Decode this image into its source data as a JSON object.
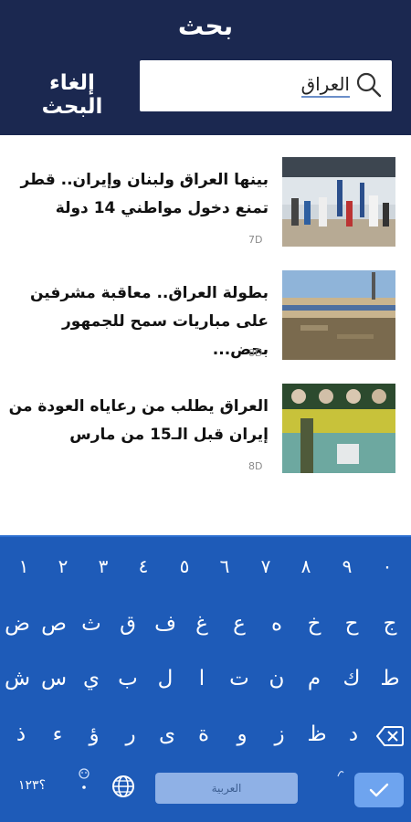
{
  "header": {
    "title": "بحث",
    "search_value": "العراق",
    "cancel_label": "إلغاء البحث"
  },
  "results": [
    {
      "headline": "بينها العراق ولبنان وإيران.. قطر تمنع دخول مواطني 14 دولة",
      "age": "7D"
    },
    {
      "headline": "بطولة العراق.. معاقبة مشرفين على مباريات سمح للجمهور بحض...",
      "age": "8D"
    },
    {
      "headline": "العراق يطلب من رعاياه العودة من إيران قبل الـ15 من مارس",
      "age": "8D"
    }
  ],
  "keyboard": {
    "numbers": [
      "١",
      "٢",
      "٣",
      "٤",
      "٥",
      "٦",
      "٧",
      "٨",
      "٩",
      "٠"
    ],
    "row1": [
      "ض",
      "ص",
      "ث",
      "ق",
      "ف",
      "غ",
      "ع",
      "ه",
      "خ",
      "ح",
      "ج"
    ],
    "row2": [
      "ش",
      "س",
      "ي",
      "ب",
      "ل",
      "ا",
      "ت",
      "ن",
      "م",
      "ك",
      "ط"
    ],
    "row3": [
      "ذ",
      "ء",
      "ؤ",
      "ر",
      "ى",
      "ة",
      "و",
      "ز",
      "ظ",
      "د"
    ],
    "symbols_label": "؟١٢٣",
    "space_label": "العربية"
  },
  "colors": {
    "header_bg": "#1b2850",
    "keyboard_bg": "#1e5bb8"
  }
}
